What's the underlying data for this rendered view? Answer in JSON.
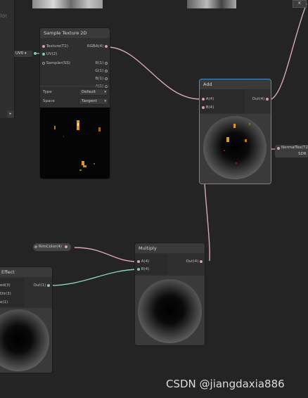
{
  "left_panel": {
    "faded_label": "lor",
    "uv_value": "UV0"
  },
  "sample_texture": {
    "title": "Sample Texture 2D",
    "inputs": [
      "Texture(T2)",
      "UV(2)",
      "Sampler(SS)"
    ],
    "outputs": [
      "RGBA(4)",
      "R(1)",
      "G(1)",
      "B(1)",
      "A(1)"
    ],
    "type_label": "Type",
    "type_value": "Default",
    "space_label": "Space",
    "space_value": "Tangent"
  },
  "add_node": {
    "title": "Add",
    "inputs": [
      "A(4)",
      "B(4)"
    ],
    "output": "Out(4)"
  },
  "normal_pill": {
    "label": "NormalTex(T2",
    "sub_label": "SDR"
  },
  "rim_pill": {
    "label": "RimColor(4)"
  },
  "multiply_node": {
    "title": "Multiply",
    "inputs": [
      "A(4)",
      "B(4)"
    ],
    "output": "Out(4)"
  },
  "effect_node": {
    "title": "Effect",
    "inputs": [
      "ed(3)",
      "Dir(3)",
      "e(1)"
    ],
    "output": "Out(1)"
  },
  "top_right_button": "K",
  "watermark": "CSDN @jiangdaxia886",
  "colors": {
    "background": "#242424",
    "edge_pink": "#d8a7b9",
    "edge_teal": "#8ad0bf",
    "selected_border": "#4a8fc8",
    "texture_highlight": "#e09a1f"
  }
}
